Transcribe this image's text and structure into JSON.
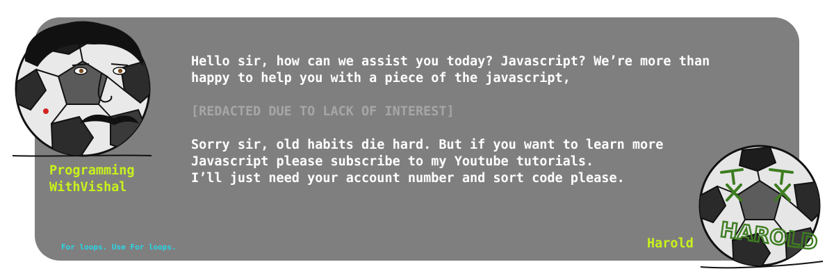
{
  "dialog": {
    "para1": [
      "Hello sir, how can we assist you today? Javascript? We’re more than",
      "happy to help you with a piece of the javascript,"
    ],
    "redacted": "[REDACTED DUE TO LACK OF INTEREST]",
    "para2": [
      "Sorry sir, old habits die hard. But if you want to learn more",
      "Javascript please subscribe to my Youtube tutorials.",
      "I’ll just need your account number and sort code please."
    ]
  },
  "left_character": {
    "name_lines": [
      "Programming",
      "WithVishal"
    ],
    "icon": "soccer-ball-face-icon"
  },
  "right_character": {
    "name": "Harold",
    "ball_scrawl": "HAROLD",
    "icon": "soccer-ball-harold-icon"
  },
  "tagline": "For loops. Use For loops.",
  "colors": {
    "card_background": "#7f7f7f",
    "dialog_text": "#ffffff",
    "redacted_text": "#a6a6a6",
    "name_text": "#c8f21c",
    "tagline_text": "#2ad6e6",
    "scrawl_green": "#3e7d22"
  }
}
